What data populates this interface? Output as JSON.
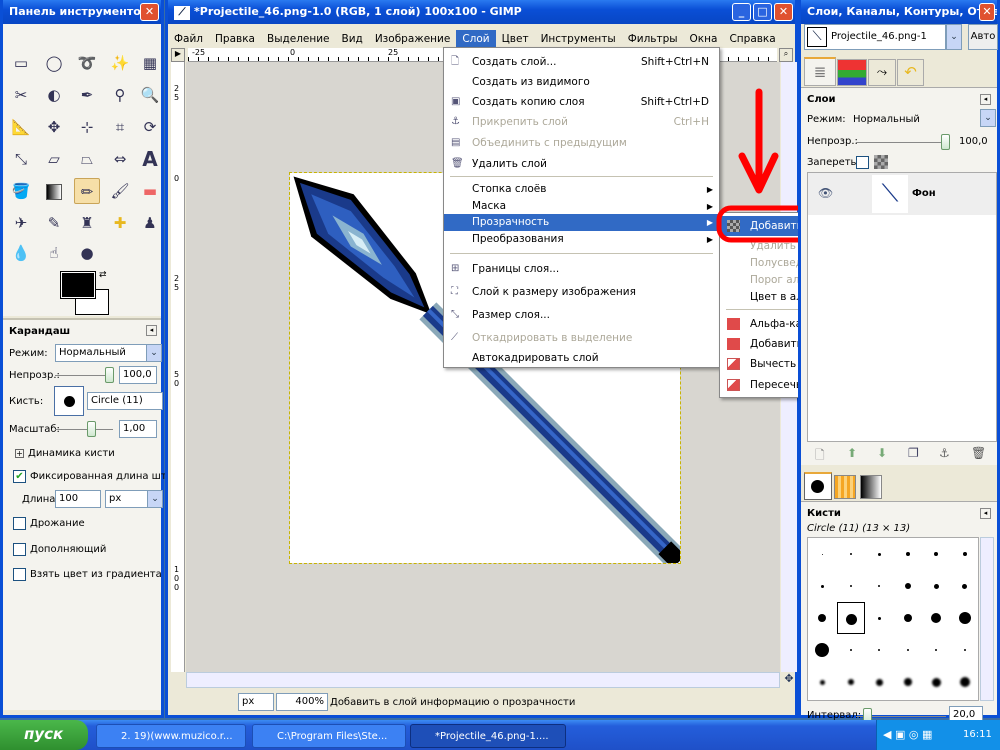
{
  "toolbox": {
    "title": "Панель инструментов",
    "tool_options_title": "Карандаш",
    "mode_label": "Режим:",
    "mode_value": "Нормальный",
    "opacity_label": "Непрозр.:",
    "opacity_value": "100,0",
    "brush_label": "Кисть:",
    "brush_value": "Circle (11)",
    "scale_label": "Масштаб:",
    "scale_value": "1,00",
    "dynamics_label": "Динамика кисти",
    "fixed_length_label": "Фиксированная длина штриха",
    "length_label": "Длина:",
    "length_value": "100",
    "length_unit": "px",
    "jitter_label": "Дрожание",
    "incremental_label": "Дополняющий",
    "gradient_color_label": "Взять цвет из градиента",
    "opacity_percent": 100,
    "scale_fraction": 0.5
  },
  "main": {
    "title": "*Projectile_46.png-1.0 (RGB, 1 слой) 100x100 - GIMP",
    "menubar": [
      "Файл",
      "Правка",
      "Выделение",
      "Вид",
      "Изображение",
      "Слой",
      "Цвет",
      "Инструменты",
      "Фильтры",
      "Окна",
      "Справка"
    ],
    "ruler_top": [
      "-25",
      "0",
      "25"
    ],
    "ruler_left": [
      "2",
      "5",
      "0",
      "2",
      "5",
      "5",
      "0",
      "1",
      "0",
      "0"
    ],
    "status_unit": "px",
    "zoom": "400%",
    "status_text": "Добавить в слой информацию о прозрачности"
  },
  "layer_menu": {
    "items": [
      {
        "label": "Создать слой...",
        "shortcut": "Shift+Ctrl+N",
        "disabled": false
      },
      {
        "label": "Создать из видимого",
        "shortcut": "",
        "disabled": false
      },
      {
        "label": "Создать копию слоя",
        "shortcut": "Shift+Ctrl+D",
        "disabled": false
      },
      {
        "label": "Прикрепить слой",
        "shortcut": "Ctrl+H",
        "disabled": true
      },
      {
        "label": "Объединить с предыдущим",
        "shortcut": "",
        "disabled": true
      },
      {
        "label": "Удалить слой",
        "shortcut": "",
        "disabled": false
      },
      {
        "label": "Стопка слоёв",
        "submenu": true
      },
      {
        "label": "Маска",
        "submenu": true
      },
      {
        "label": "Прозрачность",
        "submenu": true,
        "highlighted": true
      },
      {
        "label": "Преобразования",
        "submenu": true
      },
      {
        "label": "Границы слоя...",
        "disabled": false
      },
      {
        "label": "Слой к размеру изображения",
        "disabled": false
      },
      {
        "label": "Размер слоя...",
        "disabled": false
      },
      {
        "label": "Откадрировать в выделение",
        "disabled": true
      },
      {
        "label": "Автокадрировать слой",
        "disabled": false
      }
    ]
  },
  "transparency_menu": {
    "items": [
      {
        "label": "Добавить альфа-канал",
        "highlighted": true
      },
      {
        "label": "Удалить альфа-канал",
        "disabled": true
      },
      {
        "label": "Полусведение",
        "disabled": true
      },
      {
        "label": "Порог альфа-канала...",
        "disabled": true
      },
      {
        "label": "Цвет в альфа-канал..."
      },
      {
        "label": "Альфа-канал в выделение"
      },
      {
        "label": "Добавить к выделению"
      },
      {
        "label": "Вычесть из выделения"
      },
      {
        "label": "Пересечь с выделением"
      }
    ]
  },
  "dock": {
    "title": "Слои, Каналы, Контуры, Отме...",
    "image_name": "Projectile_46.png-1",
    "auto_button": "Авто",
    "layers_title": "Слои",
    "mode_label": "Режим:",
    "mode_value": "Нормальный",
    "opacity_label": "Непрозр.:",
    "opacity_value": "100,0",
    "lock_label": "Запереть:",
    "layer_name": "Фон",
    "brushes_title": "Кисти",
    "brush_info": "Circle (11) (13 × 13)",
    "spacing_label": "Интервал:",
    "spacing_value": "20,0"
  },
  "taskbar": {
    "start": "пуск",
    "items": [
      "2. 19)(www.muzico.r...",
      "C:\\Program Files\\Ste...",
      "*Projectile_46.png-1...."
    ],
    "clock": "16:11"
  },
  "colors": {
    "highlight": "#316ac5",
    "annotation": "#ff0000",
    "titlebar": "#0a4fd6"
  }
}
